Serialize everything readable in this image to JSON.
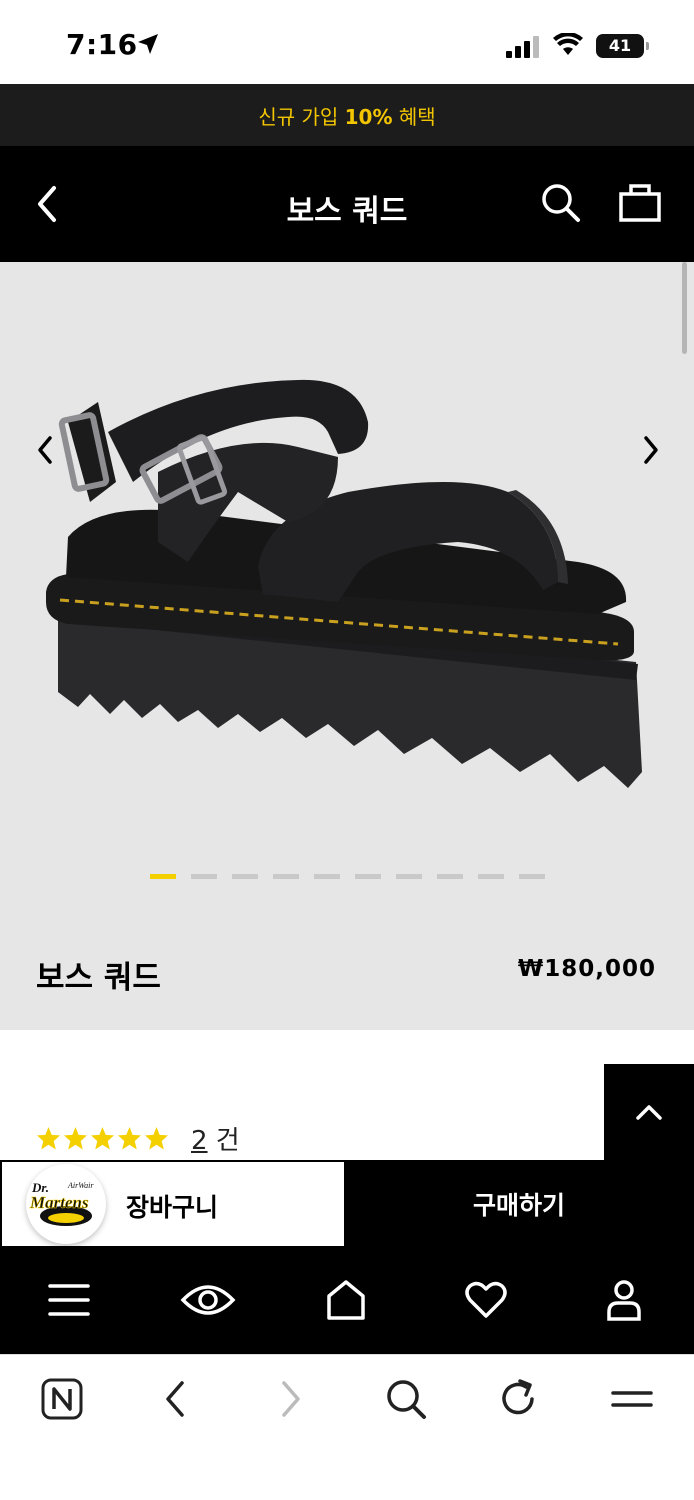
{
  "status": {
    "time": "7:16",
    "battery": "41"
  },
  "promo": {
    "prefix": "신규 가입 ",
    "highlight": "10%",
    "suffix": " 혜택"
  },
  "header": {
    "title": "보스 쿼드"
  },
  "product": {
    "name": "보스 쿼드",
    "price": "₩180,000",
    "image_count": 10,
    "active_image": 0
  },
  "reviews": {
    "rating": 5,
    "count": "2",
    "unit": " 건"
  },
  "purchase": {
    "cart_label": "장바구니",
    "buy_label": "구매하기",
    "brand_logo": "Dr. Martens"
  },
  "icons": {
    "back": "chevron-left-icon",
    "search": "search-icon",
    "bag": "shopping-bag-icon",
    "menu": "hamburger-icon",
    "recent": "eye-icon",
    "home": "home-icon",
    "wishlist": "heart-icon",
    "account": "user-icon"
  },
  "colors": {
    "accent": "#f4d000",
    "promo": "#f2c500"
  }
}
